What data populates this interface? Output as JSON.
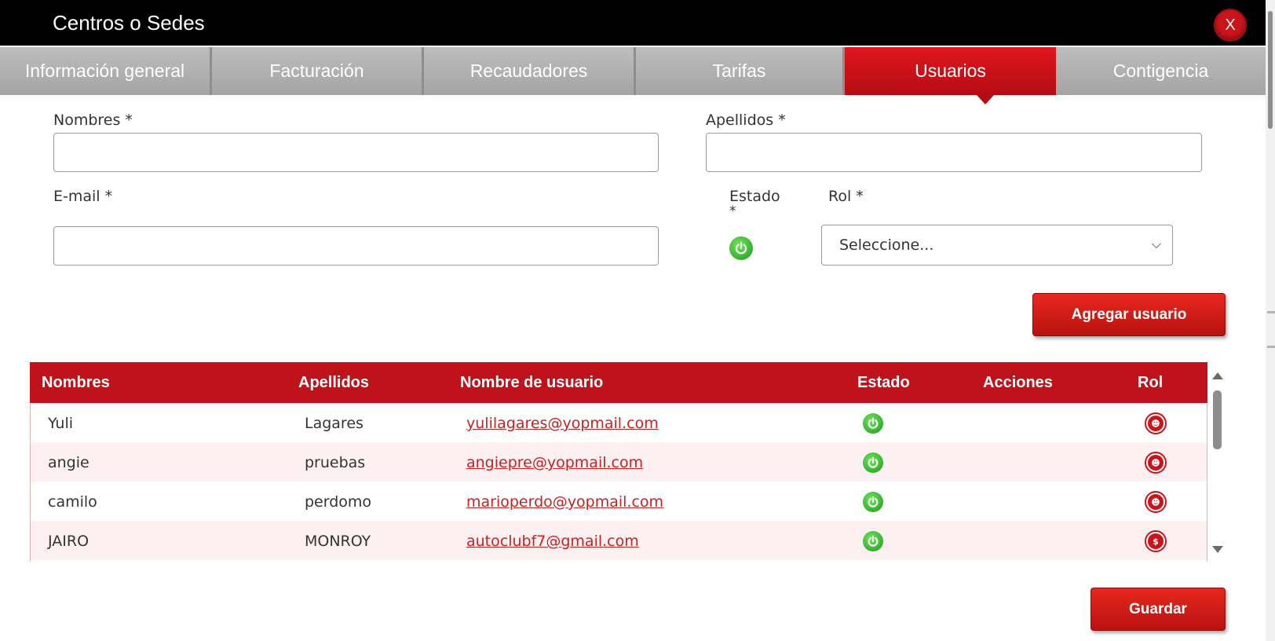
{
  "window": {
    "title": "Centros o Sedes",
    "close_label": "X"
  },
  "tabs": [
    {
      "label": "Información general",
      "active": false
    },
    {
      "label": "Facturación",
      "active": false
    },
    {
      "label": "Recaudadores",
      "active": false
    },
    {
      "label": "Tarifas",
      "active": false
    },
    {
      "label": "Usuarios",
      "active": true
    },
    {
      "label": "Contigencia",
      "active": false
    }
  ],
  "form": {
    "nombres_label": "Nombres *",
    "nombres_value": "",
    "apellidos_label": "Apellidos *",
    "apellidos_value": "",
    "email_label": "E-mail *",
    "email_value": "",
    "estado_label": "Estado",
    "estado_asterisk": "*",
    "estado_icon": "power-icon",
    "rol_label": "Rol *",
    "rol_selected": "Seleccione...",
    "add_button": "Agregar usuario"
  },
  "table": {
    "headers": [
      "Nombres",
      "Apellidos",
      "Nombre de usuario",
      "Estado",
      "Acciones",
      "Rol"
    ],
    "rows": [
      {
        "nombre": "Yuli",
        "apellido": "Lagares",
        "usuario": "yulilagares@yopmail.com",
        "estado_icon": "power-icon",
        "rol_icon": "user-role-icon"
      },
      {
        "nombre": "angie",
        "apellido": "pruebas",
        "usuario": "angiepre@yopmail.com",
        "estado_icon": "power-icon",
        "rol_icon": "user-role-icon"
      },
      {
        "nombre": "camilo",
        "apellido": "perdomo",
        "usuario": "marioperdo@yopmail.com",
        "estado_icon": "power-icon",
        "rol_icon": "user-role-icon"
      },
      {
        "nombre": "JAIRO",
        "apellido": "MONROY",
        "usuario": "autoclubf7@gmail.com",
        "estado_icon": "power-icon",
        "rol_icon": "money-bag-icon"
      }
    ]
  },
  "footer": {
    "save_button": "Guardar"
  },
  "colors": {
    "accent": "#c0121a",
    "tab_inactive": "#a9a9a9",
    "status_on": "#2fb52a",
    "link": "#cc1f1f"
  }
}
